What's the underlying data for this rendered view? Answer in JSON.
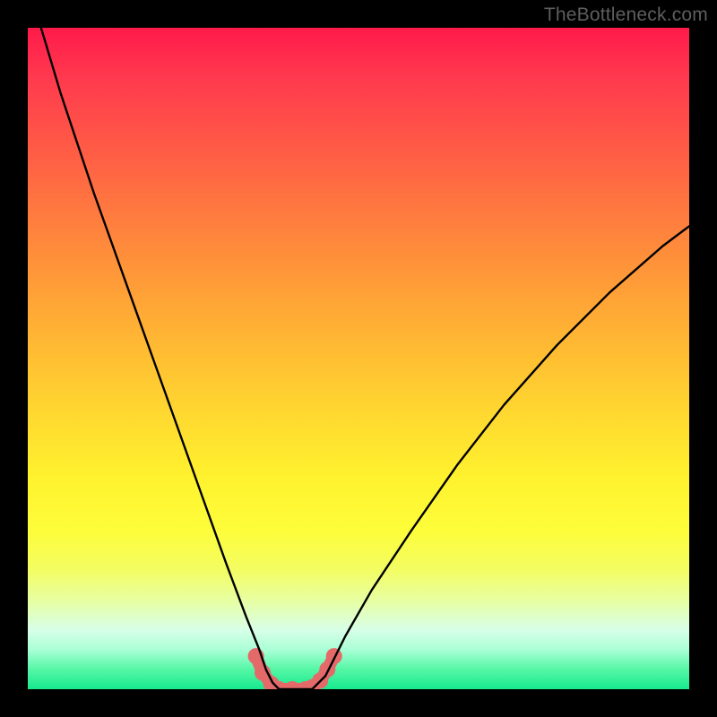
{
  "watermark": "TheBottleneck.com",
  "chart_data": {
    "type": "line",
    "title": "",
    "xlabel": "",
    "ylabel": "",
    "xlim": [
      0,
      100
    ],
    "ylim": [
      0,
      100
    ],
    "grid": false,
    "series": [
      {
        "name": "bottleneck-curve",
        "x": [
          2,
          5,
          10,
          15,
          20,
          25,
          30,
          33,
          35,
          36,
          37,
          38,
          40,
          42,
          43,
          44,
          45,
          46,
          48,
          52,
          58,
          65,
          72,
          80,
          88,
          96,
          100
        ],
        "y": [
          100,
          90,
          75,
          61,
          47,
          33,
          19,
          11,
          6,
          3,
          1,
          0,
          0,
          0,
          0,
          1,
          2,
          4,
          8,
          15,
          24,
          34,
          43,
          52,
          60,
          67,
          70
        ],
        "color": "#000000",
        "stroke_width": 2
      },
      {
        "name": "sweet-spot-marker",
        "x": [
          34.5,
          35.5,
          36.8,
          38,
          40,
          42,
          43,
          44.2,
          45.3,
          46.3
        ],
        "y": [
          5,
          2.5,
          0.8,
          0,
          0,
          0,
          0.3,
          1.3,
          3,
          5
        ],
        "color": "#e46a6a",
        "stroke_width": 12,
        "marker": "circle"
      }
    ],
    "background_gradient_colors": [
      "#ff1a4a",
      "#ffd730",
      "#fdfd3a",
      "#17e98e"
    ]
  }
}
